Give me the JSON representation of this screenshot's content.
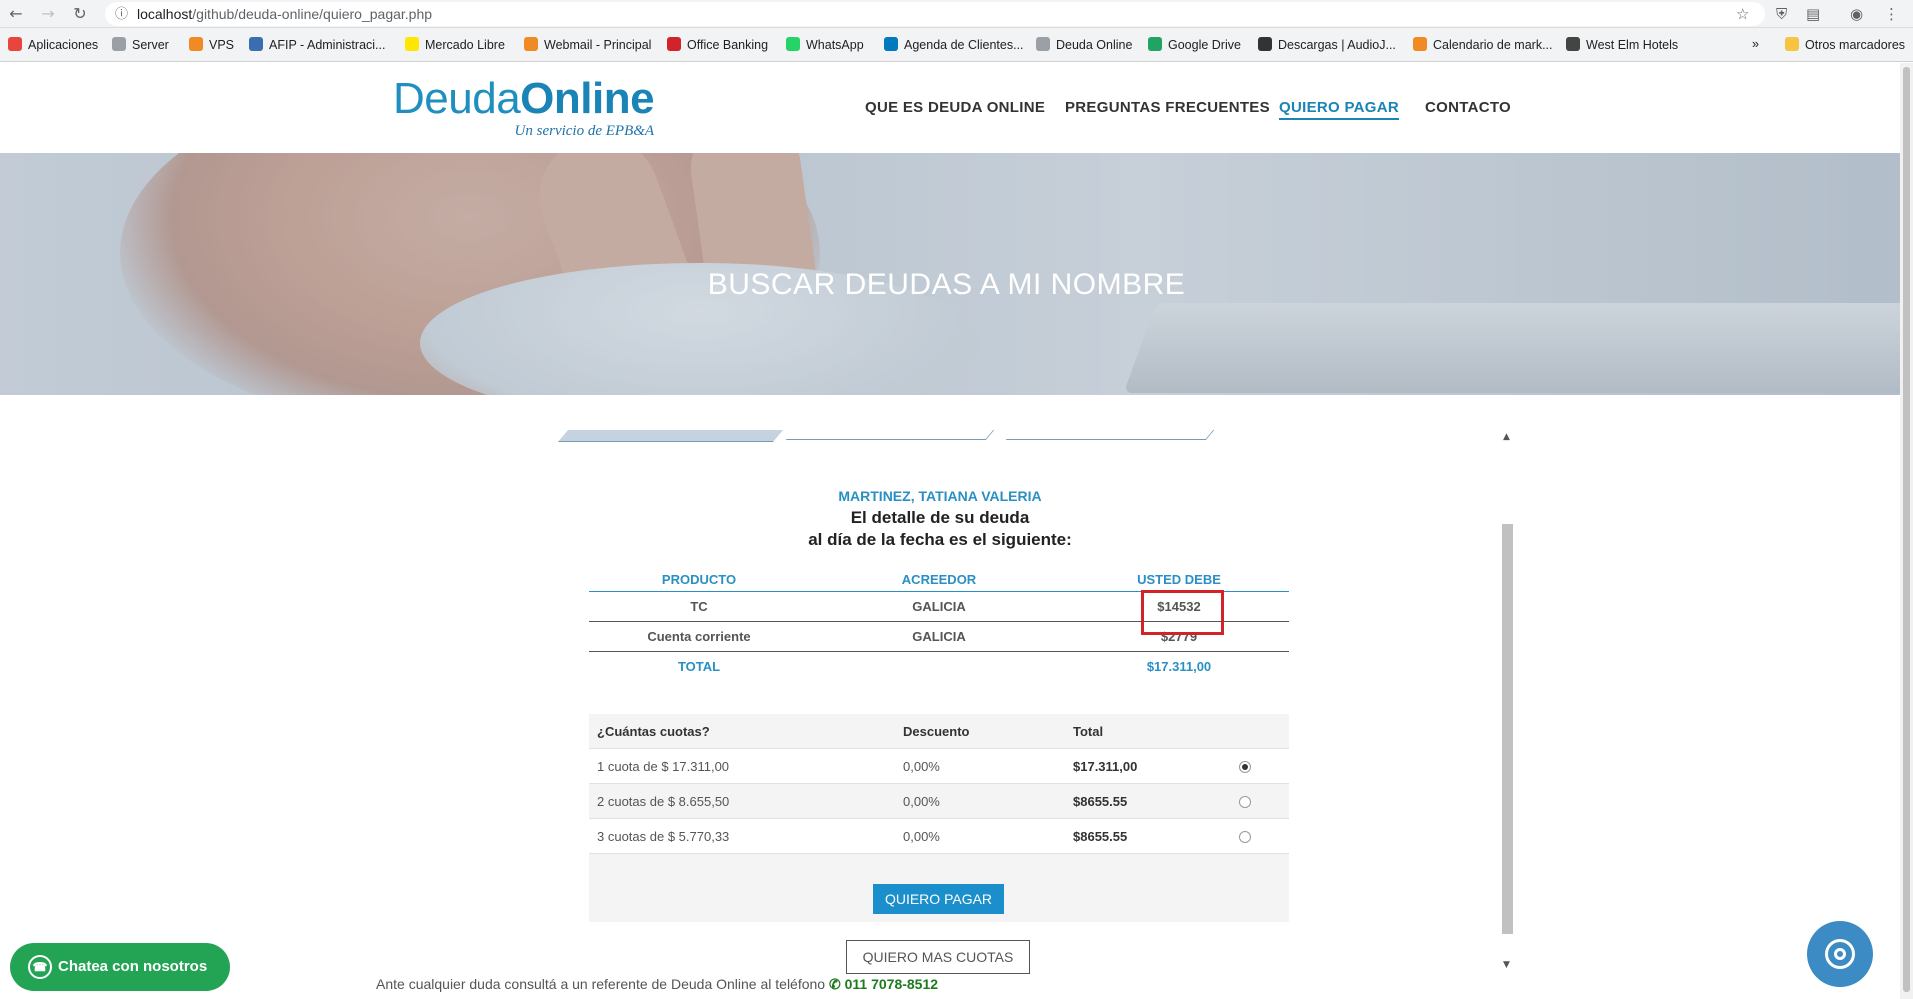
{
  "browser": {
    "url_host": "localhost",
    "url_path": "/github/deuda-online/quiero_pagar.php",
    "bookmarks": [
      {
        "label": "Aplicaciones",
        "color": "#e8453c"
      },
      {
        "label": "Server",
        "color": "#9aa0a6"
      },
      {
        "label": "VPS",
        "color": "#f08a24"
      },
      {
        "label": "AFIP - Administraci...",
        "color": "#3b6db3"
      },
      {
        "label": "Mercado Libre",
        "color": "#ffe600"
      },
      {
        "label": "Webmail - Principal",
        "color": "#f08a24"
      },
      {
        "label": "Office Banking",
        "color": "#d2232a"
      },
      {
        "label": "WhatsApp",
        "color": "#25d366"
      },
      {
        "label": "Agenda de Clientes...",
        "color": "#0079bf"
      },
      {
        "label": "Deuda Online",
        "color": "#9aa0a6"
      },
      {
        "label": "Google Drive",
        "color": "#1fa463"
      },
      {
        "label": "Descargas | AudioJ...",
        "color": "#333333"
      },
      {
        "label": "Calendario de mark...",
        "color": "#f08a24"
      },
      {
        "label": "West Elm Hotels",
        "color": "#444444"
      }
    ],
    "other_bookmarks": "Otros marcadores"
  },
  "header": {
    "logo_main_a": "Deuda",
    "logo_main_b": "Online",
    "logo_sub": "Un servicio de EPB&A",
    "nav": [
      "QUE ES DEUDA ONLINE",
      "PREGUNTAS FRECUENTES",
      "QUIERO PAGAR",
      "CONTACTO"
    ],
    "active_nav": "QUIERO PAGAR"
  },
  "hero": {
    "title": "BUSCAR DEUDAS A MI NOMBRE"
  },
  "debtor": {
    "name": "MARTINEZ, TATIANA VALERIA",
    "line1": "El detalle de su deuda",
    "line2": "al día de la fecha es el siguiente:"
  },
  "debts": {
    "headers": [
      "PRODUCTO",
      "ACREEDOR",
      "USTED DEBE"
    ],
    "rows": [
      {
        "producto": "TC",
        "acreedor": "GALICIA",
        "debe": "$14532"
      },
      {
        "producto": "Cuenta corriente",
        "acreedor": "GALICIA",
        "debe": "$2779"
      }
    ],
    "total_label": "TOTAL",
    "total_value": "$17.311,00"
  },
  "plan": {
    "headers": [
      "¿Cuántas cuotas?",
      "Descuento",
      "Total"
    ],
    "rows": [
      {
        "cuotas": "1 cuota de $ 17.311,00",
        "descuento": "0,00%",
        "total": "$17.311,00",
        "selected": true
      },
      {
        "cuotas": "2 cuotas de $ 8.655,50",
        "descuento": "0,00%",
        "total": "$8655.55",
        "selected": false
      },
      {
        "cuotas": "3 cuotas de $ 5.770,33",
        "descuento": "0,00%",
        "total": "$8655.55",
        "selected": false
      }
    ]
  },
  "actions": {
    "pay": "QUIERO PAGAR",
    "more": "QUIERO MAS CUOTAS"
  },
  "help": {
    "text": "Ante cualquier duda consultá a un referente de Deuda Online al teléfono",
    "phone": "011 7078-8512"
  },
  "whatsapp": {
    "label": "Chatea con nosotros"
  },
  "colors": {
    "brand": "#1a84b6",
    "highlight": "#d2232a",
    "whatsapp": "#23a455"
  }
}
